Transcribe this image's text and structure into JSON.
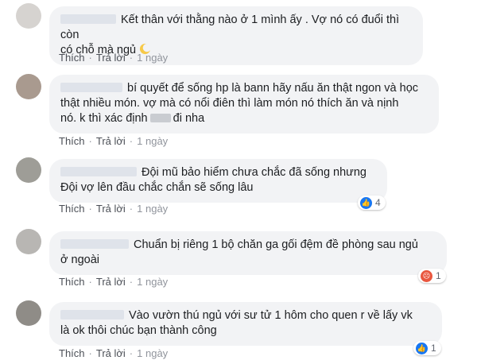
{
  "colors": {
    "bubble": "#f2f3f5",
    "like": "#1877f2",
    "angry": "#e9573f",
    "action_text": "#4b4f56"
  },
  "actions": {
    "like": "Thích",
    "reply": "Trả lời",
    "separator": "·"
  },
  "comments": [
    {
      "line1": "Kết thân với thằng nào ở 1 mình ấy . Vợ nó có đuổi thì còn",
      "line2": "có chỗ mà ngủ",
      "emoji": "moon-icon",
      "time": "1 ngày"
    },
    {
      "line1": "bí quyết để sống hp là bann hãy nấu ăn thật ngon và học",
      "line2": "thật nhiều món. vợ mà có nổi điên thì làm món nó thích ăn và nịnh",
      "line3a": "nó. k thì xác định",
      "line3b": "đi nha",
      "time": "1 ngày"
    },
    {
      "line1": "Đội mũ bảo hiểm chưa chắc đã sống nhưng",
      "line2": "Đội vợ lên đầu chắc chắn sẽ sống lâu",
      "time": "1 ngày",
      "reaction": {
        "type": "like-icon",
        "count": "4"
      }
    },
    {
      "line1": "Chuẩn bị riêng 1 bộ chăn ga gối đệm đề phòng sau ngủ",
      "line2": "ở ngoài",
      "time": "1 ngày",
      "reaction": {
        "type": "angry-icon",
        "count": "1"
      }
    },
    {
      "line1": "Vào vườn thú ngủ với sư tử 1 hôm cho quen r về lấy vk",
      "line2": "là ok thôi chúc bạn thành công",
      "time": "1 ngày",
      "reaction": {
        "type": "like-icon",
        "count": "1"
      }
    }
  ]
}
